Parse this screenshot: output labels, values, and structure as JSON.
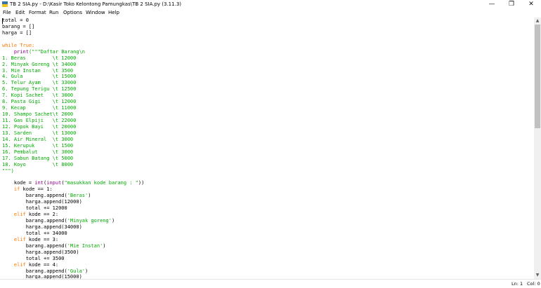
{
  "window": {
    "title": "TB 2 SIA.py - D:\\Kasir Toko Kelontong Pamungkas\\TB 2 SIA.py (3.11.3)",
    "minimize": "—",
    "maximize": "❐",
    "close": "✕"
  },
  "menu": [
    "File",
    "Edit",
    "Format",
    "Run",
    "Options",
    "Window",
    "Help"
  ],
  "code_lines": [
    [
      {
        "t": "total = 0"
      }
    ],
    [
      {
        "t": "barang = []"
      }
    ],
    [
      {
        "t": "harga = []"
      }
    ],
    [
      {
        "t": ""
      }
    ],
    [
      {
        "t": "while True:",
        "c": "kw"
      }
    ],
    [
      {
        "t": "    "
      },
      {
        "t": "print",
        "c": "bi"
      },
      {
        "t": "(\"\"\"Daftar Barang\\n",
        "c": "str"
      }
    ],
    [
      {
        "t": "1. Beras         \\t 12000",
        "c": "str"
      }
    ],
    [
      {
        "t": "2. Minyak Goreng \\t 34000",
        "c": "str"
      }
    ],
    [
      {
        "t": "3. Mie Instan    \\t 3500",
        "c": "str"
      }
    ],
    [
      {
        "t": "4. Gula          \\t 15000",
        "c": "str"
      }
    ],
    [
      {
        "t": "5. Telur Ayam    \\t 33000",
        "c": "str"
      }
    ],
    [
      {
        "t": "6. Tepung Terigu \\t 12500",
        "c": "str"
      }
    ],
    [
      {
        "t": "7. Kopi Sachet   \\t 3000",
        "c": "str"
      }
    ],
    [
      {
        "t": "8. Pasta Gigi    \\t 12000",
        "c": "str"
      }
    ],
    [
      {
        "t": "9. Kecap         \\t 11000",
        "c": "str"
      }
    ],
    [
      {
        "t": "10. Shampo Sachet\\t 2000",
        "c": "str"
      }
    ],
    [
      {
        "t": "11. Gas Elpiji   \\t 22000",
        "c": "str"
      }
    ],
    [
      {
        "t": "12. Popok Bayi   \\t 20000",
        "c": "str"
      }
    ],
    [
      {
        "t": "13. Sarden       \\t 13000",
        "c": "str"
      }
    ],
    [
      {
        "t": "14. Air Mineral  \\t 3000",
        "c": "str"
      }
    ],
    [
      {
        "t": "15. Kerupuk      \\t 1500",
        "c": "str"
      }
    ],
    [
      {
        "t": "16. Pembalut     \\t 3000",
        "c": "str"
      }
    ],
    [
      {
        "t": "17. Sabun Batang \\t 5000",
        "c": "str"
      }
    ],
    [
      {
        "t": "18. Koyo         \\t 8000",
        "c": "str"
      }
    ],
    [
      {
        "t": "\"\"\")",
        "c": "str"
      }
    ],
    [
      {
        "t": ""
      }
    ],
    [
      {
        "t": "    kode = "
      },
      {
        "t": "int",
        "c": "bi"
      },
      {
        "t": "("
      },
      {
        "t": "input",
        "c": "bi"
      },
      {
        "t": "("
      },
      {
        "t": "\"masukkan kode barang : \"",
        "c": "str"
      },
      {
        "t": "))"
      }
    ],
    [
      {
        "t": "    "
      },
      {
        "t": "if",
        "c": "kw"
      },
      {
        "t": " kode == 1:"
      }
    ],
    [
      {
        "t": "        barang.append("
      },
      {
        "t": "'Beras'",
        "c": "str"
      },
      {
        "t": ")"
      }
    ],
    [
      {
        "t": "        harga.append(12000)"
      }
    ],
    [
      {
        "t": "        total += 12000"
      }
    ],
    [
      {
        "t": "    "
      },
      {
        "t": "elif",
        "c": "kw"
      },
      {
        "t": " kode == 2:"
      }
    ],
    [
      {
        "t": "        barang.append("
      },
      {
        "t": "'Minyak goreng'",
        "c": "str"
      },
      {
        "t": ")"
      }
    ],
    [
      {
        "t": "        harga.append(34000)"
      }
    ],
    [
      {
        "t": "        total += 34000"
      }
    ],
    [
      {
        "t": "    "
      },
      {
        "t": "elif",
        "c": "kw"
      },
      {
        "t": " kode == 3:"
      }
    ],
    [
      {
        "t": "        barang.append("
      },
      {
        "t": "'Mie Instan'",
        "c": "str"
      },
      {
        "t": ")"
      }
    ],
    [
      {
        "t": "        harga.append(3500)"
      }
    ],
    [
      {
        "t": "        total += 3500"
      }
    ],
    [
      {
        "t": "    "
      },
      {
        "t": "elif",
        "c": "kw"
      },
      {
        "t": " kode == 4:"
      }
    ],
    [
      {
        "t": "        barang.append("
      },
      {
        "t": "'Gula'",
        "c": "str"
      },
      {
        "t": ")"
      }
    ],
    [
      {
        "t": "        harga.append(15000)"
      }
    ]
  ],
  "status": {
    "line": "Ln: 1",
    "col": "Col: 0"
  },
  "colors": {
    "keyword": "#ff7700",
    "builtin": "#900090",
    "string": "#00aa00"
  }
}
